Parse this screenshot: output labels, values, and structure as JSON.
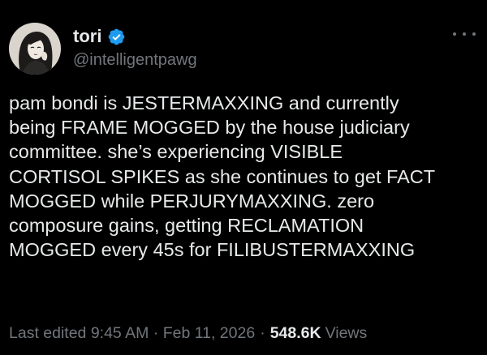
{
  "tweet": {
    "author": {
      "display_name": "tori",
      "handle": "@intelligentpawg",
      "verified": true,
      "avatar_icon": "avatar-illustration"
    },
    "more_icon": "more-horizontal-icon",
    "text": "pam bondi is JESTERMAXXING and currently\nbeing FRAME MOGGED by the house judiciary\ncommittee. she’s experiencing VISIBLE\nCORTISOL SPIKES as she continues to get FACT\nMOGGED while PERJURYMAXXING. zero\ncomposure gains, getting RECLAMATION\nMOGGED every 45s for FILIBUSTERMAXXING",
    "meta": {
      "last_edited": "Last edited 9:45 AM · Feb 11, 2026",
      "separator": "·",
      "views_count": "548.6K",
      "views_label": "Views"
    }
  },
  "colors": {
    "background": "#000000",
    "primary_text": "#e7e9ea",
    "secondary_text": "#71767b",
    "verified_blue": "#1d9bf0"
  }
}
